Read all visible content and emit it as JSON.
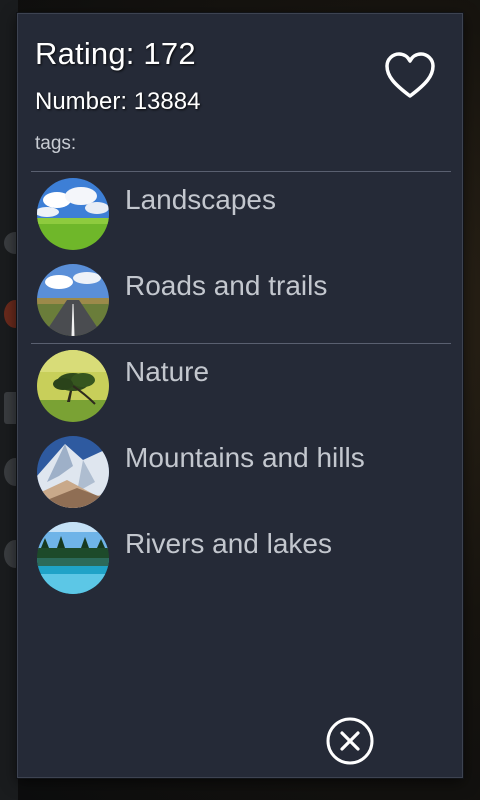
{
  "dialog": {
    "rating_text": "Rating: 172",
    "number_text": "Number: 13884",
    "tags_label": "tags:"
  },
  "tags": [
    {
      "label": "Landscapes",
      "thumbnail": "landscape-field"
    },
    {
      "label": "Roads and trails",
      "thumbnail": "road"
    },
    {
      "label": "Nature",
      "thumbnail": "tree"
    },
    {
      "label": "Mountains and hills",
      "thumbnail": "mountain"
    },
    {
      "label": "Rivers and lakes",
      "thumbnail": "lake"
    }
  ],
  "icons": {
    "favorite": "heart-outline-icon",
    "close": "close-circle-icon"
  },
  "colors": {
    "dialog_bg": "#252a37",
    "label_text": "#c3c7ce",
    "title_text": "#ffffff",
    "divider": "#5a6070"
  }
}
